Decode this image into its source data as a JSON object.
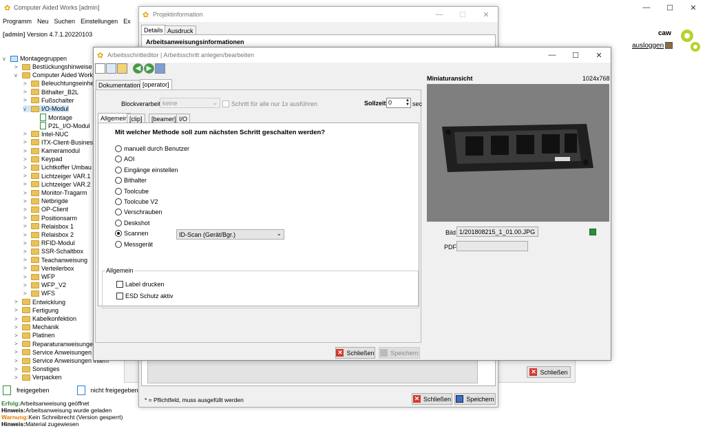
{
  "main": {
    "title": "Computer Aided Works [admin]",
    "menu": [
      "Programm",
      "Neu",
      "Suchen",
      "Einstellungen",
      "Ex"
    ],
    "admin_label": "[admin]",
    "version": "Version 4.7.1.20220103",
    "user": "caw",
    "logout": "ausloggen",
    "tree_root": "Montagegruppen",
    "tree": [
      {
        "label": "Bestückungshinweise",
        "level": 1,
        "type": "folder",
        "chev": ">"
      },
      {
        "label": "Computer Aided Works",
        "level": 1,
        "type": "folder",
        "chev": "v"
      },
      {
        "label": "Beleuchtungseinhei",
        "level": 2,
        "type": "folder",
        "chev": ">"
      },
      {
        "label": "Bithalter_B2L",
        "level": 2,
        "type": "folder",
        "chev": ">"
      },
      {
        "label": "Fußschalter",
        "level": 2,
        "type": "folder",
        "chev": ">"
      },
      {
        "label": "I/O-Modul",
        "level": 2,
        "type": "folder",
        "chev": "v",
        "sel": true
      },
      {
        "label": "Montage",
        "level": 3,
        "type": "doc",
        "chev": ""
      },
      {
        "label": "P2L_I/O-Modul",
        "level": 3,
        "type": "doc",
        "chev": ""
      },
      {
        "label": "Intel-NUC",
        "level": 2,
        "type": "folder",
        "chev": ">"
      },
      {
        "label": "ITX-Client-Business",
        "level": 2,
        "type": "folder",
        "chev": ">"
      },
      {
        "label": "Kameramodul",
        "level": 2,
        "type": "folder",
        "chev": ">"
      },
      {
        "label": "Keypad",
        "level": 2,
        "type": "folder",
        "chev": ">"
      },
      {
        "label": "Lichtkoffer Umbau",
        "level": 2,
        "type": "folder",
        "chev": ">"
      },
      {
        "label": "Lichtzeiger VAR.1",
        "level": 2,
        "type": "folder",
        "chev": ">"
      },
      {
        "label": "Lichtzeiger VAR.2",
        "level": 2,
        "type": "folder",
        "chev": ">"
      },
      {
        "label": "Monitor-Tragarm",
        "level": 2,
        "type": "folder",
        "chev": ">"
      },
      {
        "label": "Netbrigde",
        "level": 2,
        "type": "folder",
        "chev": ">"
      },
      {
        "label": "OP-Client",
        "level": 2,
        "type": "folder",
        "chev": ">"
      },
      {
        "label": "Positionsarm",
        "level": 2,
        "type": "folder",
        "chev": ">"
      },
      {
        "label": "Relaisbox 1",
        "level": 2,
        "type": "folder",
        "chev": ">"
      },
      {
        "label": "Relaisbox 2",
        "level": 2,
        "type": "folder",
        "chev": ">"
      },
      {
        "label": "RFID-Modul",
        "level": 2,
        "type": "folder",
        "chev": ">"
      },
      {
        "label": "SSR-Schaltbox",
        "level": 2,
        "type": "folder",
        "chev": ">"
      },
      {
        "label": "Teachanweisung",
        "level": 2,
        "type": "folder",
        "chev": ">"
      },
      {
        "label": "Verteilerbox",
        "level": 2,
        "type": "folder",
        "chev": ">"
      },
      {
        "label": "WFP",
        "level": 2,
        "type": "folder",
        "chev": ">"
      },
      {
        "label": "WFP_V2",
        "level": 2,
        "type": "folder",
        "chev": ">"
      },
      {
        "label": "WFS",
        "level": 2,
        "type": "folder",
        "chev": ">"
      },
      {
        "label": "Entwicklung",
        "level": 1,
        "type": "folder",
        "chev": ">"
      },
      {
        "label": "Fertigung",
        "level": 1,
        "type": "folder",
        "chev": ">"
      },
      {
        "label": "Kabelkonfektion",
        "level": 1,
        "type": "folder",
        "chev": ">"
      },
      {
        "label": "Mechanik",
        "level": 1,
        "type": "folder",
        "chev": ">"
      },
      {
        "label": "Platinen",
        "level": 1,
        "type": "folder",
        "chev": ">"
      },
      {
        "label": "Reparaturanweisungen",
        "level": 1,
        "type": "folder",
        "chev": ">"
      },
      {
        "label": "Service Anweisungen e",
        "level": 1,
        "type": "folder",
        "chev": ">"
      },
      {
        "label": "Service Anweisungen intern",
        "level": 1,
        "type": "folder",
        "chev": ">"
      },
      {
        "label": "Sonstiges",
        "level": 1,
        "type": "folder",
        "chev": ">"
      },
      {
        "label": "Verpacken",
        "level": 1,
        "type": "folder",
        "chev": ">"
      }
    ],
    "legend_released": "freigegeben",
    "legend_unreleased": "nicht freigegeben",
    "log": [
      {
        "prefix": "Erfolg:",
        "text": "Arbeitsanweisung geöffnet",
        "color": "#2e7d32"
      },
      {
        "prefix": "Hinweis:",
        "text": "Arbeitsanweisung wurde geladen",
        "color": "#000000"
      },
      {
        "prefix": "Warnung:",
        "text": "Kein Schreibrecht (Version gesperrt)",
        "color": "#e07b00"
      },
      {
        "prefix": "Hinweis:",
        "text": "Material zugewiesen",
        "color": "#000000"
      }
    ],
    "close_button": "Schließen"
  },
  "projekt": {
    "title": "Projektinformation",
    "tabs": [
      "Details",
      "Ausdruck"
    ],
    "section_title": "Arbeitsanweisungsinformationen",
    "footnote": "* = Pflichtfeld, muss ausgefüllt werden",
    "close_button": "Schließen",
    "save_button": "Speichern"
  },
  "editor": {
    "title": "Arbeitsschritteditor | Arbeitsschritt anlegen/bearbeiten",
    "tabs": [
      "Dokumentation",
      "[operator]"
    ],
    "block_label": "Blockverarbeitung",
    "block_value": "keine",
    "once_label": "Schritt für alle nur 1x ausführen",
    "sollzeit_label": "Sollzeit",
    "sollzeit_value": "0",
    "sollzeit_unit": "sec",
    "subtabs": [
      "Allgemein",
      "[clip]",
      "[beamer]",
      "I/O"
    ],
    "question": "Mit welcher Methode soll zum nächsten Schritt geschalten werden?",
    "methods": [
      {
        "label": "manuell durch Benutzer",
        "checked": false
      },
      {
        "label": "AOI",
        "checked": false
      },
      {
        "label": "Eingänge einstellen",
        "checked": false
      },
      {
        "label": "Bithalter",
        "checked": false
      },
      {
        "label": "Toolcube",
        "checked": false
      },
      {
        "label": "Toolcube V2",
        "checked": false
      },
      {
        "label": "Verschrauben",
        "checked": false
      },
      {
        "label": "Deskshot",
        "checked": false
      },
      {
        "label": "Scannen",
        "checked": true
      },
      {
        "label": "Messgerät",
        "checked": false
      }
    ],
    "scan_select": "ID-Scan (Gerät/Bgr.)",
    "group_title": "Allgemein",
    "label_print": "Label drucken",
    "esd": "ESD Schutz aktiv",
    "preview_title": "Miniaturansicht",
    "preview_size": "1024x768",
    "bild_label": "Bild",
    "bild_value": "1/201808215_1_01.00.JPG",
    "pdf_label": "PDF",
    "pdf_value": "",
    "close_button": "Schließen",
    "save_button": "Speichern"
  }
}
